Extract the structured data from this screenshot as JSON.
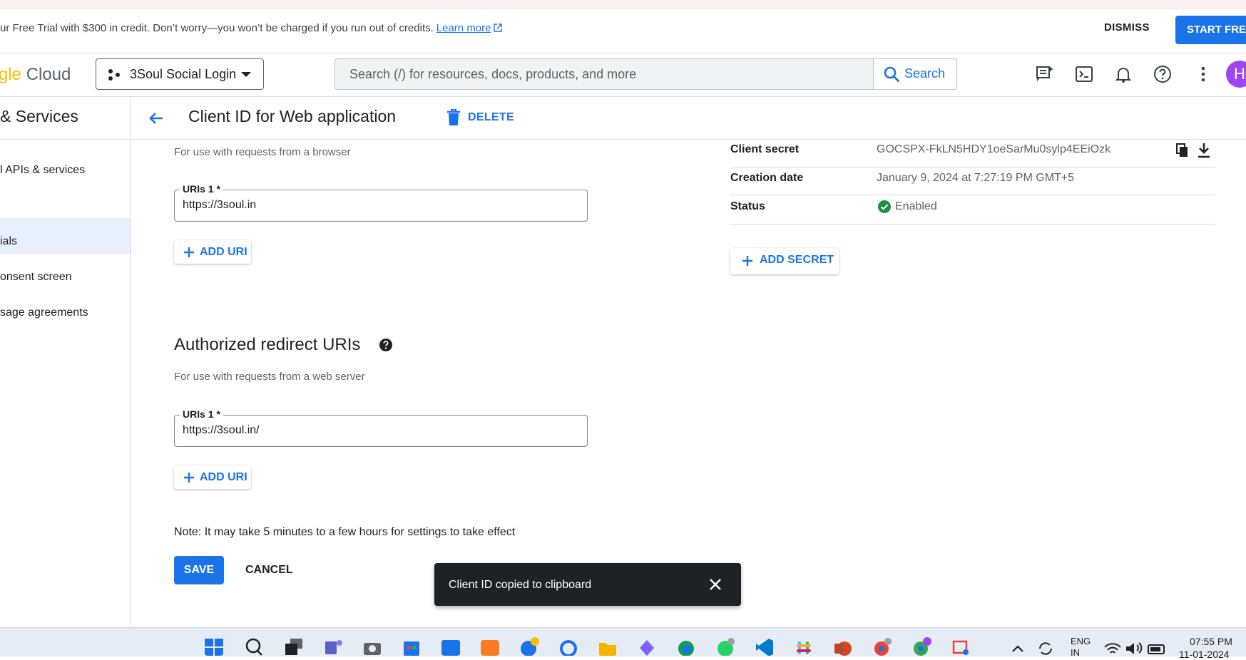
{
  "banner": {
    "text": "ur Free Trial with $300 in credit. Don’t worry—you won’t be charged if you run out of credits.",
    "learn_more": "Learn more",
    "dismiss": "DISMISS",
    "start": "START FREE"
  },
  "header": {
    "logo_part1": "gle",
    "logo_part2": " Cloud",
    "project": "3Soul Social Login",
    "search_placeholder": "Search (/) for resources, docs, products, and more",
    "search_button": "Search",
    "avatar_letter": "H"
  },
  "sidebar": {
    "title": "& Services",
    "items": [
      {
        "label": "l APIs & services"
      },
      {
        "label": "ials"
      },
      {
        "label": "onsent screen"
      },
      {
        "label": "sage agreements"
      }
    ]
  },
  "page": {
    "title": "Client ID for Web application",
    "delete": "DELETE"
  },
  "origins": {
    "hint": "For use with requests from a browser",
    "field_label": "URIs 1 *",
    "value": "https://3soul.in",
    "add_uri": "ADD URI"
  },
  "redirects": {
    "title": "Authorized redirect URIs",
    "hint": "For use with requests from a web server",
    "field_label": "URIs 1 *",
    "value": "https://3soul.in/",
    "add_uri": "ADD URI"
  },
  "note": "Note: It may take 5 minutes to a few hours for settings to take effect",
  "actions": {
    "save": "SAVE",
    "cancel": "CANCEL"
  },
  "details": {
    "client_secret_key": "Client secret",
    "client_secret_val": "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",
    "creation_key": "Creation date",
    "creation_val": "January 9, 2024 at 7:27:19 PM GMT+5",
    "status_key": "Status",
    "status_val": "Enabled",
    "add_secret": "ADD SECRET"
  },
  "snackbar": {
    "text": "Client ID copied to clipboard"
  },
  "taskbar": {
    "lang_line1": "ENG",
    "lang_line2": "IN",
    "time": "07:55 PM",
    "date": "11-01-2024"
  },
  "colors": {
    "accent": "#1a73e8",
    "snackbar_bg": "#202124",
    "active_nav_bg": "#e8f0fe",
    "status_green": "#1e8e3e"
  }
}
